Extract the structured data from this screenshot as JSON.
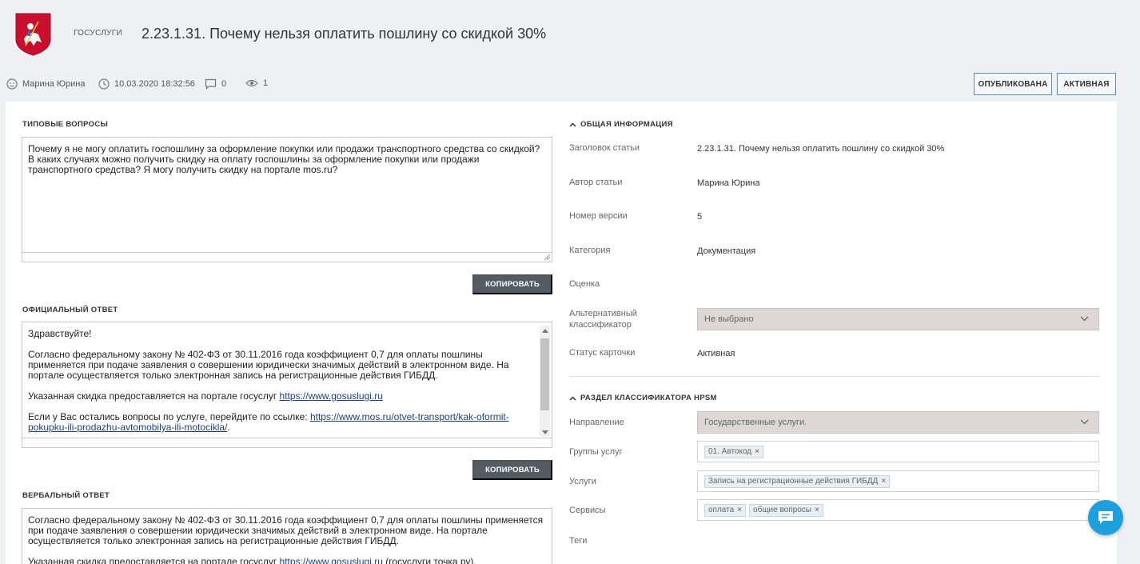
{
  "header": {
    "brand": "ГОСУСЛУГИ",
    "title": "2.23.1.31. Почему нельзя оплатить пошлину со скидкой 30%"
  },
  "meta": {
    "author": "Марина Юрина",
    "datetime": "10.03.2020 18:32:56",
    "comments": "0",
    "views": "1"
  },
  "status_buttons": {
    "published": "ОПУБЛИКОВАНА",
    "active": "АКТИВНАЯ"
  },
  "left": {
    "typical_questions": {
      "label": "ТИПОВЫЕ ВОПРОСЫ",
      "text": "Почему я не могу оплатить госпошлину за оформление покупки или продажи транспортного средства со скидкой? В каких случаях можно получить скидку на оплату госпошлины за оформление покупки или продажи транспортного средства? Я могу получить скидку на портале mos.ru?"
    },
    "copy_label": "КОПИРОВАТЬ",
    "official_answer": {
      "label": "ОФИЦИАЛЬНЫЙ ОТВЕТ",
      "greeting": "Здравствуйте!",
      "p1": "Согласно федеральному закону № 402-ФЗ от 30.11.2016 года коэффициент 0,7 для оплаты пошлины применяется при подаче заявления о совершении юридически значимых действий в электронном виде. На портале осуществляется только электронная запись на регистрационные действия ГИБДД.",
      "p2_text": "Указанная скидка предоставляется на портале госуслуг ",
      "p2_link": "https://www.gosuslugi.ru",
      "p3_text": "Если у Вас остались вопросы по услуге, перейдите по ссылке: ",
      "p3_link": "https://www.mos.ru/otvet-transport/kak-oformit-pokupku-ili-prodazhu-avtomobilya-ili-motocikla/",
      "p3_tail": "."
    },
    "verbal_answer": {
      "label": "ВЕРБАЛЬНЫЙ ОТВЕТ",
      "p1": "Согласно федеральному закону № 402-ФЗ от 30.11.2016 года коэффициент 0,7 для оплаты пошлины применяется при подаче заявления о совершении юридически значимых действий в электронном виде. На портале осуществляется только электронная запись на регистрационные действия ГИБДД.",
      "p2_text": "Указанная скидка предоставляется на портале госуслуг ",
      "p2_link": "https://www.gosuslugi.ru",
      "p2_tail": " (госуслуги точка ру)."
    }
  },
  "general_info": {
    "label": "ОБЩАЯ ИНФОРМАЦИЯ",
    "article_title_label": "Заголовок статьи",
    "article_title_value": "2.23.1.31. Почему нельзя оплатить пошлину со скидкой 30%",
    "author_label": "Автор статьи",
    "author_value": "Марина Юрина",
    "version_label": "Номер версии",
    "version_value": "5",
    "category_label": "Категория",
    "category_value": "Документация",
    "rating_label": "Оценка",
    "alt_classifier_label": "Альтернативный классификатор",
    "alt_classifier_value": "Не выбрано",
    "card_status_label": "Статус карточки",
    "card_status_value": "Активная"
  },
  "hpsm": {
    "label": "РАЗДЕЛ КЛАССИФИКАТОРА HPSM",
    "direction_label": "Направление",
    "direction_value": "Государственные услуги.",
    "service_groups_label": "Группы услуг",
    "service_groups_tags": [
      "01. Автокод"
    ],
    "services_label": "Услуги",
    "services_tags": [
      "Запись на регистрационные действия ГИБДД"
    ],
    "systems_label": "Сервисы",
    "systems_tags": [
      "оплата",
      "общие вопросы"
    ],
    "tags_label": "Теги"
  },
  "icons": {
    "logo": "moscow-coat-of-arms-icon",
    "user": "user-icon",
    "clock": "clock-icon",
    "comment": "comment-icon",
    "eye": "eye-icon",
    "chat": "chat-icon"
  },
  "colors": {
    "accent": "#1e9fde",
    "dark_button": "#545c63",
    "outline_button": "#5b8db3",
    "logo_red": "#c8102e"
  }
}
